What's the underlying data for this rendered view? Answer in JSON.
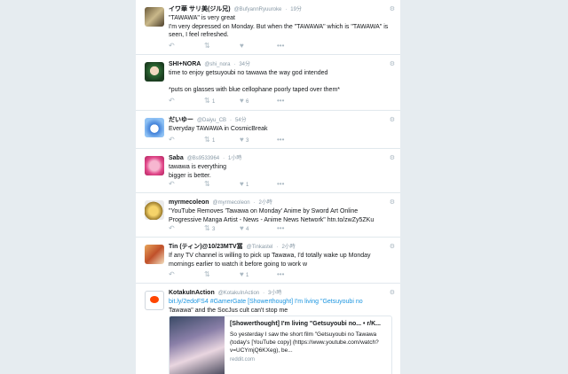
{
  "tweets": [
    {
      "name": "イワ華 サリ美(ジル兄)",
      "handle": "@BufyannRyuuroke",
      "time": "19分",
      "text_lines": [
        "\"TAWAWA\" is very great",
        "I'm very depressed on Monday. But when the \"TAWAWA\" which is \"TAWAWA\" is",
        "seen, I feel refreshed."
      ],
      "retweets": "",
      "likes": ""
    },
    {
      "name": "SHI+NORA",
      "handle": "@shi_nora",
      "time": "34分",
      "text_lines": [
        "time to enjoy getsuyoubi no tawawa the way god intended",
        "",
        "*puts on glasses with blue cellophane poorly taped over them*"
      ],
      "retweets": "1",
      "likes": "6"
    },
    {
      "name": "だいゆー",
      "handle": "@Daiyu_CB",
      "time": "54分",
      "text_lines": [
        "Everyday TAWAWA in CosmicBreak"
      ],
      "retweets": "1",
      "likes": "3"
    },
    {
      "name": "Saba",
      "handle": "@Bs9533964",
      "time": "1小時",
      "text_lines": [
        "tawawa is everything",
        "bigger is better."
      ],
      "retweets": "",
      "likes": "1"
    },
    {
      "name": "myrmecoleon",
      "handle": "@myrmecoleon",
      "time": "2小時",
      "text_lines": [
        "\"YouTube Removes 'Tawawa on Monday' Anime by Sword Art Online",
        "Progressive Manga Artist - News - Anime News Network\" htn.to/zwZy5ZKu"
      ],
      "retweets": "3",
      "likes": "4"
    },
    {
      "name": "Tin (ティン)@10/23MTV冨",
      "handle": "@Tinkastel",
      "time": "2小時",
      "text_lines": [
        "If any TV channel is willing to pick up Tawawa, I'd totally wake up Monday",
        "mornings earlier to watch it before going to work w"
      ],
      "retweets": "",
      "likes": "1"
    },
    {
      "name": "KotakuInAction",
      "handle": "@KotakuInAction",
      "time": "3小時",
      "text_lines": [
        "bit.ly/2edoFS4 #GamerGate [Showerthought] I'm living \"Getsuyoubi no",
        "Tawawa\" and the SocJus cult can't stop me"
      ],
      "retweets": "",
      "likes": ""
    }
  ],
  "card": {
    "title": "[Showerthought] I'm living \"Getsuyoubi no... • r/K...",
    "desc": "So yesterday I saw the short film \"Getsuyoubi no Tawawa (today's [YouTube copy] (https://www.youtube.com/watch?v=UCYmjQ6KXeg), be...",
    "domain": "reddit.com"
  },
  "icons": {
    "reply": "reply-icon",
    "retweet": "retweet-icon",
    "like": "heart-icon",
    "more": "more-icon",
    "follow": "follow-icon",
    "location": "location-icon"
  },
  "colors": {
    "page": "#e6ecf0",
    "link": "#1b95e0",
    "muted": "#8899a6"
  }
}
